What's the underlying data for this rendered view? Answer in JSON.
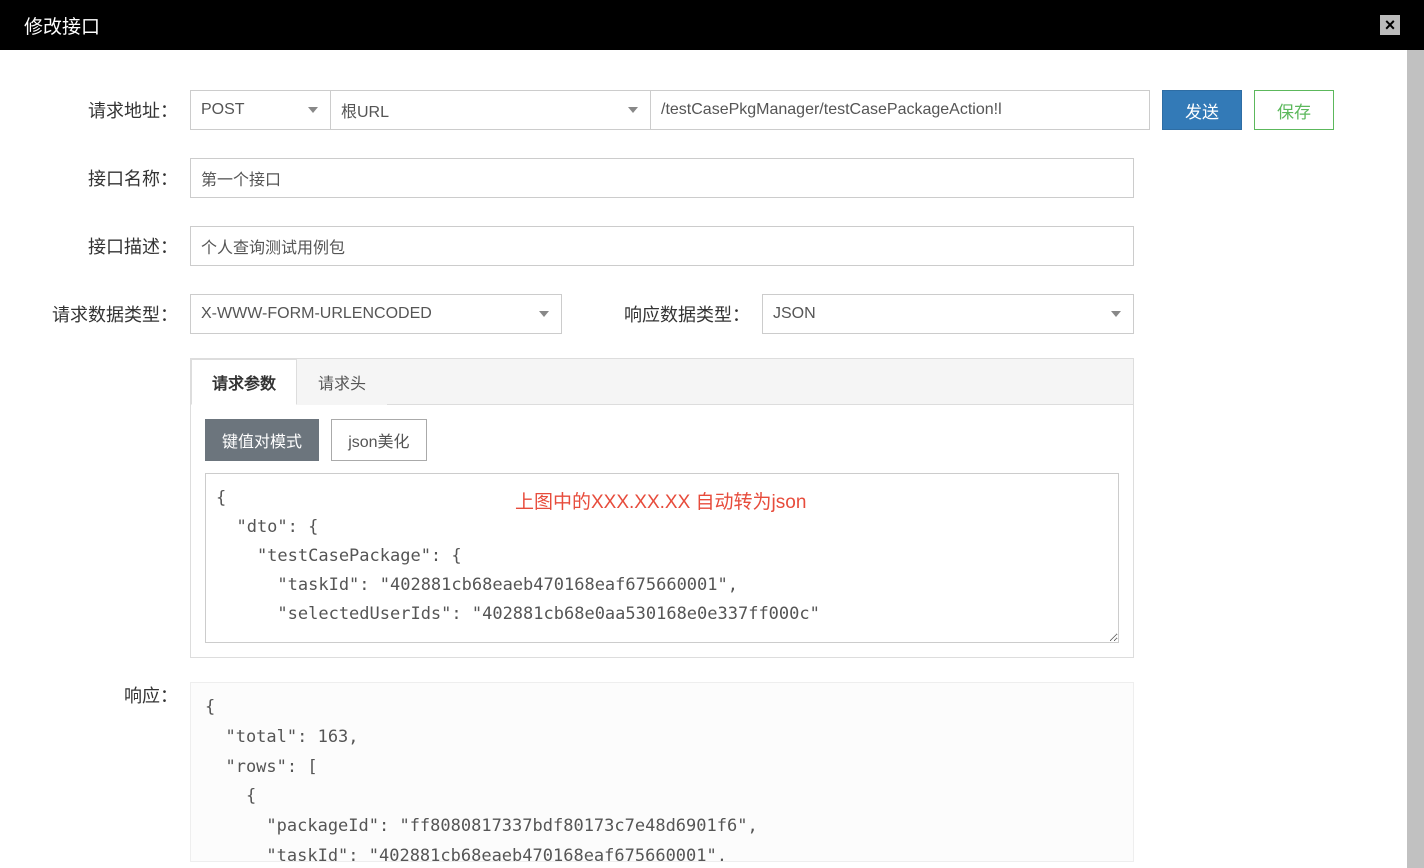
{
  "modal": {
    "title": "修改接口"
  },
  "url_row": {
    "label": "请求地址：",
    "method": "POST",
    "root_url": "根URL",
    "path": "/testCasePkgManager/testCasePackageAction!l",
    "send_btn": "发送",
    "save_btn": "保存"
  },
  "name_row": {
    "label": "接口名称：",
    "value": "第一个接口"
  },
  "desc_row": {
    "label": "接口描述：",
    "value": "个人查询测试用例包"
  },
  "type_row": {
    "req_label": "请求数据类型：",
    "req_value": "X-WWW-FORM-URLENCODED",
    "res_label": "响应数据类型：",
    "res_value": "JSON"
  },
  "params": {
    "tab1": "请求参数",
    "tab2": "请求头",
    "mode_kv": "键值对模式",
    "mode_json": "json美化",
    "body": "{\n  \"dto\": {\n    \"testCasePackage\": {\n      \"taskId\": \"402881cb68eaeb470168eaf675660001\",\n      \"selectedUserIds\": \"402881cb68e0aa530168e0e337ff000c\"",
    "annotation": "上图中的XXX.XX.XX 自动转为json"
  },
  "response": {
    "label": "响应：",
    "body": "{\n  \"total\": 163,\n  \"rows\": [\n    {\n      \"packageId\": \"ff8080817337bdf80173c7e48d6901f6\",\n      \"taskId\": \"402881cb68eaeb470168eaf675660001\","
  }
}
